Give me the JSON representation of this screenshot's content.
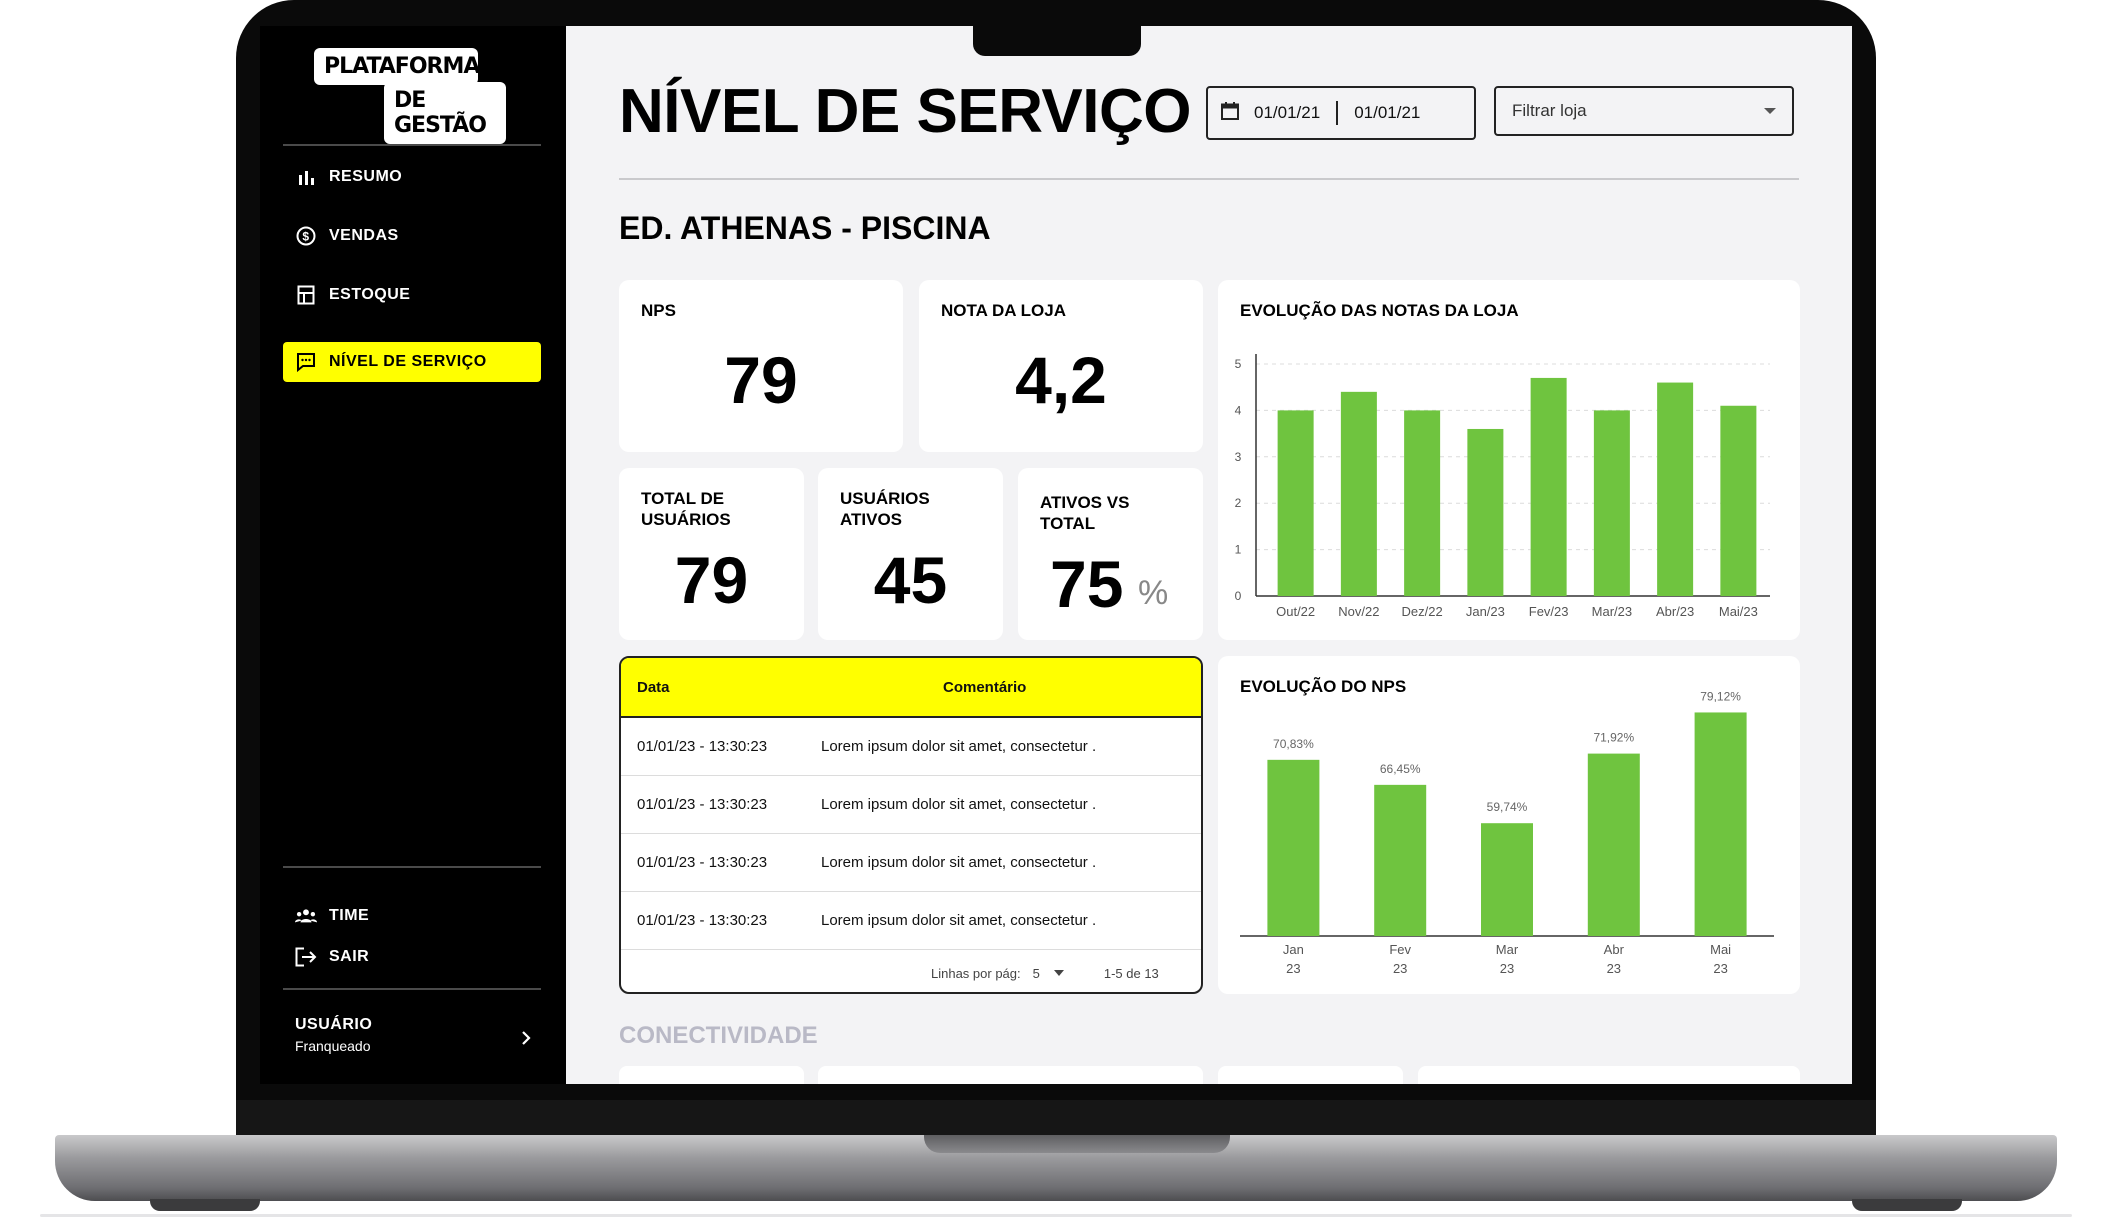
{
  "sidebar": {
    "logo_line1": "PLATAFORMA",
    "logo_line2": "DE GESTÃO",
    "nav": [
      {
        "label": "RESUMO",
        "icon": "bar-chart-icon"
      },
      {
        "label": "VENDAS",
        "icon": "dollar-circle-icon"
      },
      {
        "label": "ESTOQUE",
        "icon": "inventory-icon"
      },
      {
        "label": "NÍVEL DE SERVIÇO",
        "icon": "chat-icon",
        "active": true
      }
    ],
    "bottom_nav": [
      {
        "label": "TIME",
        "icon": "team-icon"
      },
      {
        "label": "SAIR",
        "icon": "logout-icon"
      }
    ],
    "user": {
      "name": "USUÁRIO",
      "role": "Franqueado"
    }
  },
  "header": {
    "title": "NÍVEL DE SERVIÇO",
    "date_from": "01/01/21",
    "date_to": "01/01/21",
    "filter_placeholder": "Filtrar loja"
  },
  "store": {
    "title": "ED. ATHENAS - PISCINA"
  },
  "kpis": {
    "nps": {
      "label": "NPS",
      "value": "79"
    },
    "nota": {
      "label": "NOTA DA LOJA",
      "value": "4,2"
    },
    "total_usuarios": {
      "label_l1": "TOTAL DE",
      "label_l2": "USUÁRIOS",
      "value": "79"
    },
    "usuarios_ativos": {
      "label_l1": "USUÁRIOS",
      "label_l2": "ATIVOS",
      "value": "45"
    },
    "ativos_vs_total": {
      "label_l1": "ATIVOS VS",
      "label_l2": "TOTAL",
      "value": "75",
      "unit": "%"
    }
  },
  "table": {
    "col_date": "Data",
    "col_comment": "Comentário",
    "rows": [
      {
        "date": "01/01/23 - 13:30:23",
        "comment": "Lorem ipsum dolor sit amet, consectetur ."
      },
      {
        "date": "01/01/23 - 13:30:23",
        "comment": "Lorem ipsum dolor sit amet, consectetur ."
      },
      {
        "date": "01/01/23 - 13:30:23",
        "comment": "Lorem ipsum dolor sit amet, consectetur ."
      },
      {
        "date": "01/01/23 - 13:30:23",
        "comment": "Lorem ipsum dolor sit amet, consectetur ."
      }
    ],
    "rows_per_page_label": "Linhas por pág:",
    "rows_per_page": "5",
    "range": "1-5 de 13"
  },
  "next_section": {
    "title": "CONECTIVIDADE"
  },
  "colors": {
    "accent": "#ffff00",
    "bar": "#6fc43f",
    "sidebar": "#000000"
  },
  "chart_data": [
    {
      "type": "bar",
      "title": "EVOLUÇÃO DAS NOTAS DA LOJA",
      "categories": [
        "Out/22",
        "Nov/22",
        "Dez/22",
        "Jan/23",
        "Fev/23",
        "Mar/23",
        "Abr/23",
        "Mai/23"
      ],
      "values": [
        4.0,
        4.4,
        4.0,
        3.6,
        4.7,
        4.0,
        4.6,
        4.1
      ],
      "ylim": [
        0,
        5
      ],
      "yticks": [
        "0",
        "1",
        "2",
        "3",
        "4",
        "5"
      ],
      "grid": true
    },
    {
      "type": "bar",
      "title": "EVOLUÇÃO DO NPS",
      "categories": [
        [
          "Jan",
          "23"
        ],
        [
          "Fev",
          "23"
        ],
        [
          "Mar",
          "23"
        ],
        [
          "Abr",
          "23"
        ],
        [
          "Mai",
          "23"
        ]
      ],
      "values": [
        70.83,
        66.45,
        59.74,
        71.92,
        79.12
      ],
      "data_labels": [
        "70,83%",
        "66,45%",
        "59,74%",
        "71,92%",
        "79,12%"
      ],
      "ylim": [
        40,
        82
      ]
    }
  ]
}
